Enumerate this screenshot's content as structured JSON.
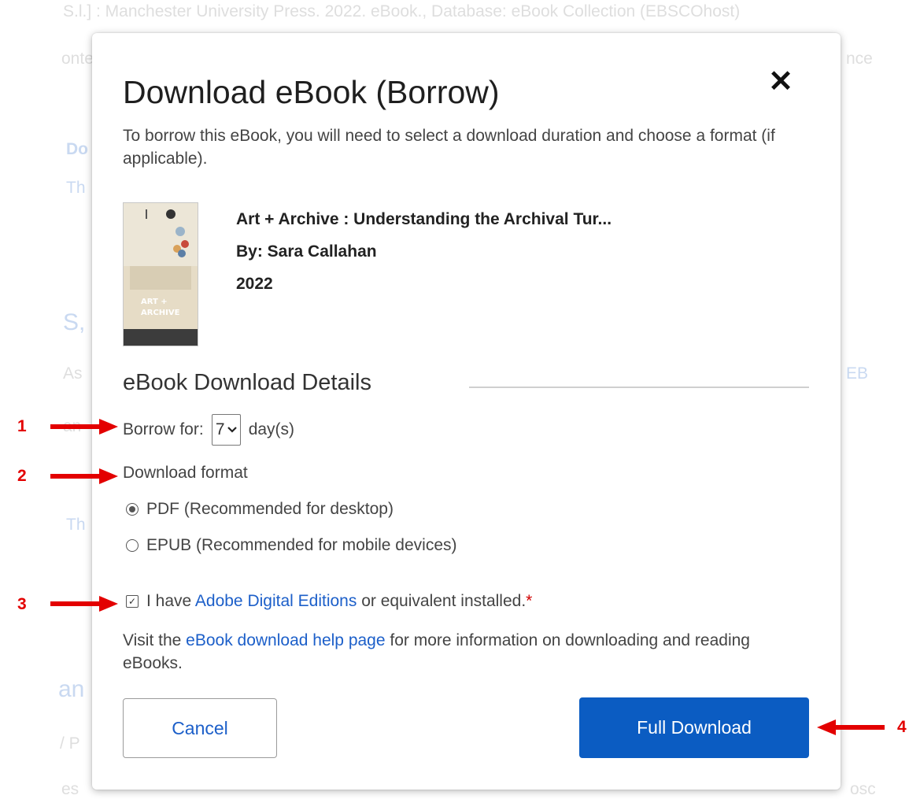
{
  "background": {
    "line1": "S.l.] : Manchester University Press. 2022. eBook., Database: eBook Collection (EBSCOhost)",
    "line2_left": "onte",
    "line2_right": "nce",
    "frag_do": "Do",
    "frag_th1": "Th",
    "frag_s": "S,",
    "frag_as": "As",
    "frag_eb": "EB",
    "frag_an1": "an",
    "frag_th2": "Th",
    "frag_an2": "an",
    "frag_p": "/ P",
    "frag_es": "es",
    "frag_os": "osc"
  },
  "modal": {
    "title": "Download eBook (Borrow)",
    "close_symbol": "✕",
    "intro": "To borrow this eBook, you will need to select a download duration and choose a format (if applicable).",
    "book": {
      "title": "Art + Archive : Understanding the Archival Tur...",
      "author": "By: Sara Callahan",
      "year": "2022",
      "cover_text": "ART + ARCHIVE"
    },
    "section_heading": "eBook Download Details",
    "borrow_label": "Borrow for:",
    "borrow_value": "7",
    "borrow_unit": "day(s)",
    "format_label": "Download format",
    "formats": [
      {
        "label": "PDF (Recommended for desktop)",
        "selected": true
      },
      {
        "label": "EPUB (Recommended for mobile devices)",
        "selected": false
      }
    ],
    "check": {
      "prefix": "I have ",
      "link": "Adobe Digital Editions",
      "suffix": " or equivalent installed.",
      "required": "*",
      "checked": true
    },
    "help": {
      "prefix": "Visit the ",
      "link": "eBook download help page",
      "suffix": " for more information on downloading and reading eBooks."
    },
    "cancel_label": "Cancel",
    "download_label": "Full Download"
  },
  "annotations": {
    "one": "1",
    "two": "2",
    "three": "3",
    "four": "4"
  },
  "colors": {
    "link": "#1c5fc9",
    "primary_button": "#0b5cc2",
    "annotation": "#e30000"
  }
}
